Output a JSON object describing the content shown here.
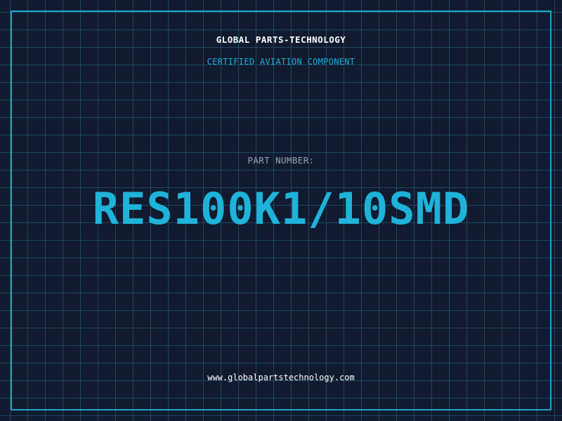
{
  "header": {
    "brand": "GLOBAL PARTS-TECHNOLOGY",
    "subtitle": "CERTIFIED AVIATION COMPONENT"
  },
  "main": {
    "part_label": "PART NUMBER:",
    "part_number": "RES100K1/10SMD"
  },
  "footer": {
    "website": "www.globalpartstechnology.com"
  },
  "colors": {
    "background": "#111a2e",
    "grid": "#266e8c",
    "accent": "#1fb3d9",
    "frame": "#1ea6cc",
    "label": "#9aa4b4",
    "text": "#ffffff"
  }
}
